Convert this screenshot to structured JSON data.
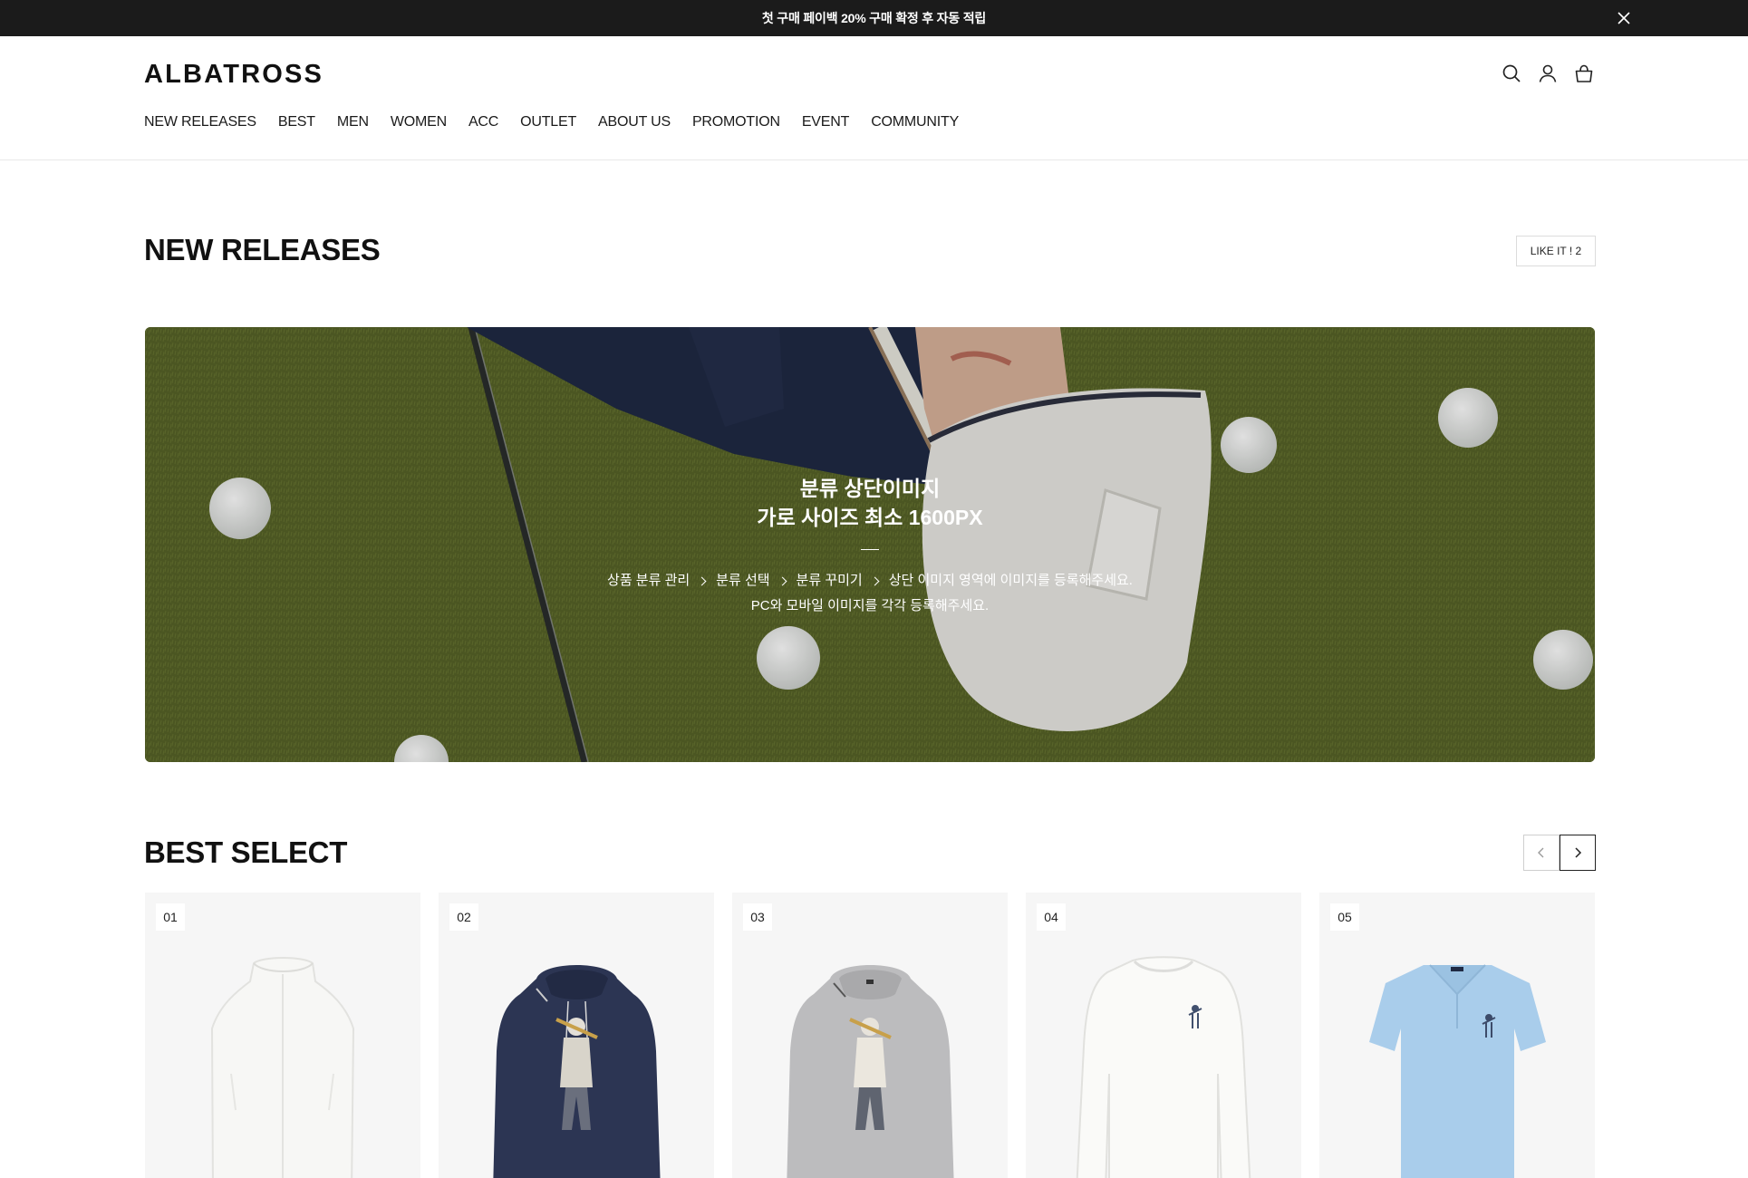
{
  "topbar": {
    "announcement": "첫 구매 페이백 20% 구매 확정 후 자동 적립",
    "close_icon": "close-icon"
  },
  "header": {
    "logo": "ALBATROSS",
    "icons": [
      "search-icon",
      "user-icon",
      "cart-icon"
    ],
    "nav": [
      "NEW RELEASES",
      "BEST",
      "MEN",
      "WOMEN",
      "ACC",
      "OUTLET",
      "ABOUT US",
      "PROMOTION",
      "EVENT",
      "COMMUNITY"
    ]
  },
  "new_releases": {
    "title": "NEW RELEASES",
    "like_button": "LIKE IT ! 2",
    "banner": {
      "title_line1": "분류 상단이미지",
      "title_line2": "가로 사이즈 최소 1600PX",
      "path": [
        "상품 분류 관리",
        "분류 선택",
        "분류 꾸미기",
        "상단 이미지 영역에 이미지를 등록해주세요."
      ],
      "desc_line2": "PC와 모바일 이미지를 각각 등록해주세요."
    }
  },
  "best_select": {
    "title": "BEST SELECT",
    "prev_icon": "chevron-left-icon",
    "next_icon": "chevron-right-icon",
    "products": [
      {
        "rank": "01",
        "item": "white padded vest",
        "color": "#f4f4f2"
      },
      {
        "rank": "02",
        "item": "navy hoodie with golfer print",
        "color": "#2c3553"
      },
      {
        "rank": "03",
        "item": "grey hoodie with golfer print",
        "color": "#b9b9bb"
      },
      {
        "rank": "04",
        "item": "white long sleeve knit",
        "color": "#f3f3f1"
      },
      {
        "rank": "05",
        "item": "light blue polo shirt",
        "color": "#a9cdeb"
      }
    ]
  }
}
